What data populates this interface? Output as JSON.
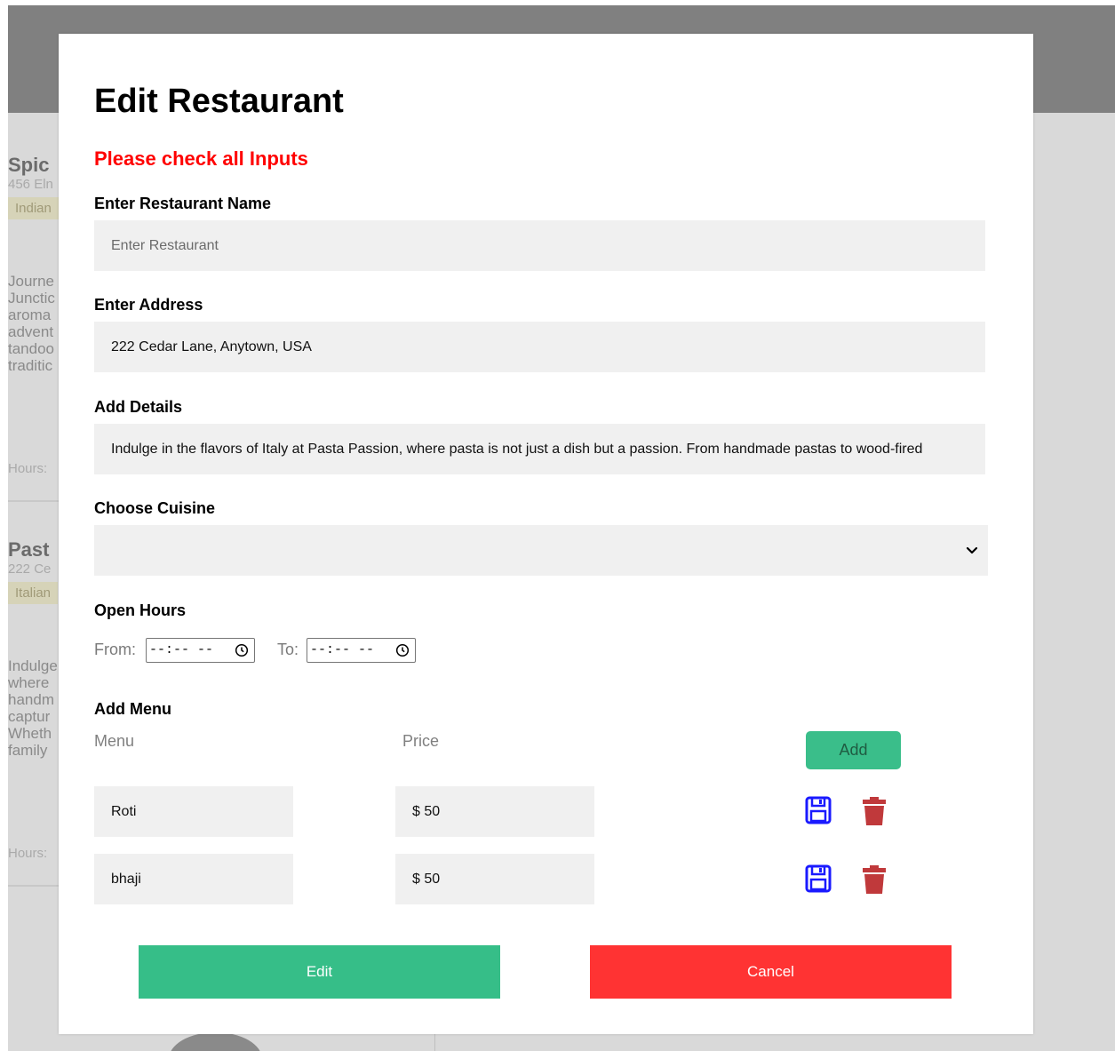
{
  "background": {
    "cards": [
      {
        "name": "Spic",
        "address": "456 Eln",
        "cuisine": "Indian",
        "description": "Journe\nJunctic\naroma\nadvent\ntandoo\ntraditic",
        "hours_label": "Hours:"
      },
      {
        "name": "Past",
        "address": "222 Ce",
        "cuisine": "Italian",
        "description": "Indulge\nwhere \nhandm\ncaptur\nWheth\nfamily",
        "hours_label": "Hours:"
      }
    ]
  },
  "modal": {
    "title": "Edit Restaurant",
    "error_message": "Please check all Inputs",
    "name_label": "Enter Restaurant Name",
    "name_placeholder": "Enter Restaurant",
    "name_value": "",
    "address_label": "Enter Address",
    "address_value": "222 Cedar Lane, Anytown, USA",
    "details_label": "Add Details",
    "details_value": "Indulge in the flavors of Italy at Pasta Passion, where pasta is not just a dish but a passion. From handmade pastas to wood-fired",
    "cuisine_label": "Choose Cuisine",
    "cuisine_value": "",
    "hours_label": "Open Hours",
    "from_label": "From:",
    "to_label": "To:",
    "from_value": "--:-- --",
    "to_value": "--:-- --",
    "menu_section_label": "Add Menu",
    "menu_col_label": "Menu",
    "price_col_label": "Price",
    "add_button": "Add",
    "menu_items": [
      {
        "name": "Roti",
        "price": "$ 50"
      },
      {
        "name": "bhaji",
        "price": "$ 50"
      }
    ],
    "edit_button": "Edit",
    "cancel_button": "Cancel"
  },
  "colors": {
    "error": "#ff0000",
    "primary_green": "#36be88",
    "danger_red": "#ff3333",
    "save_icon_blue": "#1a1aff",
    "trash_icon_red": "#c0393b"
  },
  "icons": {
    "save": "save-icon",
    "delete": "trash-icon",
    "dropdown": "chevron-down-icon",
    "clock": "clock-icon"
  }
}
